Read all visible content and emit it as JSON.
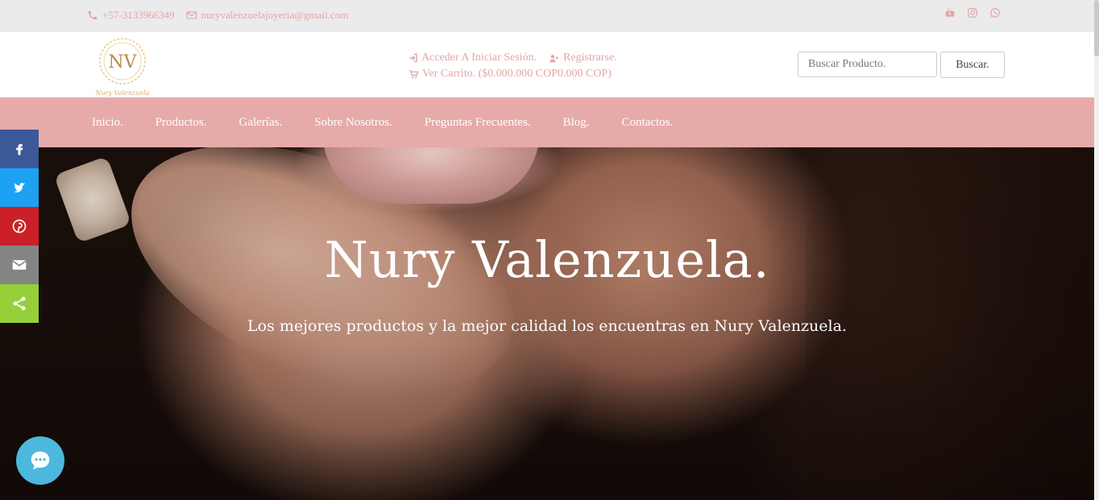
{
  "topbar": {
    "phone": "+57-3133966349",
    "email": "nuryvalenzuelajoyeria@gmail.com",
    "social": [
      "youtube-icon",
      "instagram-icon",
      "whatsapp-icon"
    ]
  },
  "header": {
    "logo_monogram": "NV",
    "logo_signature": "Nury Valenzuela",
    "login_label": "Acceder A Iniciar Sesión.",
    "register_label": "Registrarse.",
    "cart_label": "Ver Carrito. ($0.000.000 COP0.000 COP)",
    "search_placeholder": "Buscar Producto.",
    "search_button": "Buscar."
  },
  "nav": {
    "items": [
      "Inicio.",
      "Productos.",
      "Galerías.",
      "Sobre Nosotros.",
      "Preguntas Frecuentes.",
      "Blog.",
      "Contactos."
    ]
  },
  "hero": {
    "title": "Nury Valenzuela.",
    "subtitle": "Los mejores productos y la mejor calidad los encuentras en Nury Valenzuela."
  },
  "share_bar": {
    "items": [
      {
        "icon": "facebook-icon",
        "color": "#3b5998"
      },
      {
        "icon": "twitter-icon",
        "color": "#1da1f2"
      },
      {
        "icon": "pinterest-icon",
        "color": "#cb2027"
      },
      {
        "icon": "email-icon",
        "color": "#848484"
      },
      {
        "icon": "share-icon",
        "color": "#95d03a"
      }
    ]
  },
  "colors": {
    "accent": "#e6a4a4",
    "nav_bg": "#e6aaa9",
    "topbar_bg": "#ebebeb",
    "chat": "#4db8dd"
  }
}
